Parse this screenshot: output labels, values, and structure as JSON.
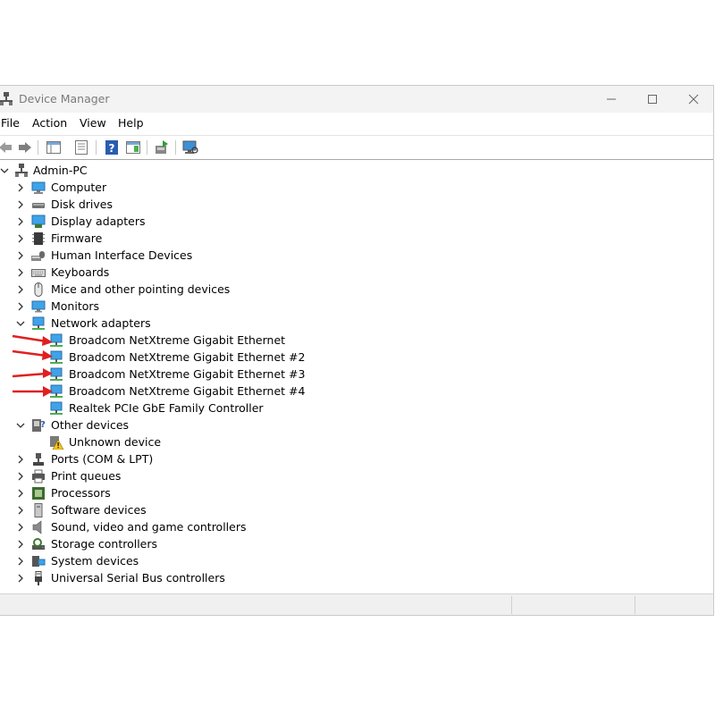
{
  "window": {
    "title": "Device Manager"
  },
  "menu": [
    "File",
    "Action",
    "View",
    "Help"
  ],
  "toolbar": {
    "buttons": [
      "back-icon",
      "forward-icon",
      "show-hide-console-tree-icon",
      "properties-icon",
      "help-icon",
      "action-pane-icon",
      "update-driver-icon",
      "scan-hardware-icon"
    ]
  },
  "tree": {
    "root": "Admin-PC",
    "categories": {
      "computer": "Computer",
      "disk_drives": "Disk drives",
      "display_adapters": "Display adapters",
      "firmware": "Firmware",
      "hid": "Human Interface Devices",
      "keyboards": "Keyboards",
      "mice": "Mice and other pointing devices",
      "monitors": "Monitors",
      "network_adapters": "Network adapters",
      "other_devices": "Other devices",
      "ports": "Ports (COM & LPT)",
      "print_queues": "Print queues",
      "processors": "Processors",
      "software_devices": "Software devices",
      "sound": "Sound, video and game controllers",
      "storage": "Storage controllers",
      "system": "System devices",
      "usb": "Universal Serial Bus controllers"
    },
    "network_devices": [
      "Broadcom NetXtreme Gigabit Ethernet",
      "Broadcom NetXtreme Gigabit Ethernet #2",
      "Broadcom NetXtreme Gigabit Ethernet #3",
      "Broadcom NetXtreme Gigabit Ethernet #4",
      "Realtek PCIe GbE Family Controller"
    ],
    "other_device_children": [
      "Unknown device"
    ]
  },
  "colors": {
    "annotation_arrow": "#e02020",
    "title_text": "#7a7a7a",
    "titlebar_bg": "#f3f3f3"
  }
}
